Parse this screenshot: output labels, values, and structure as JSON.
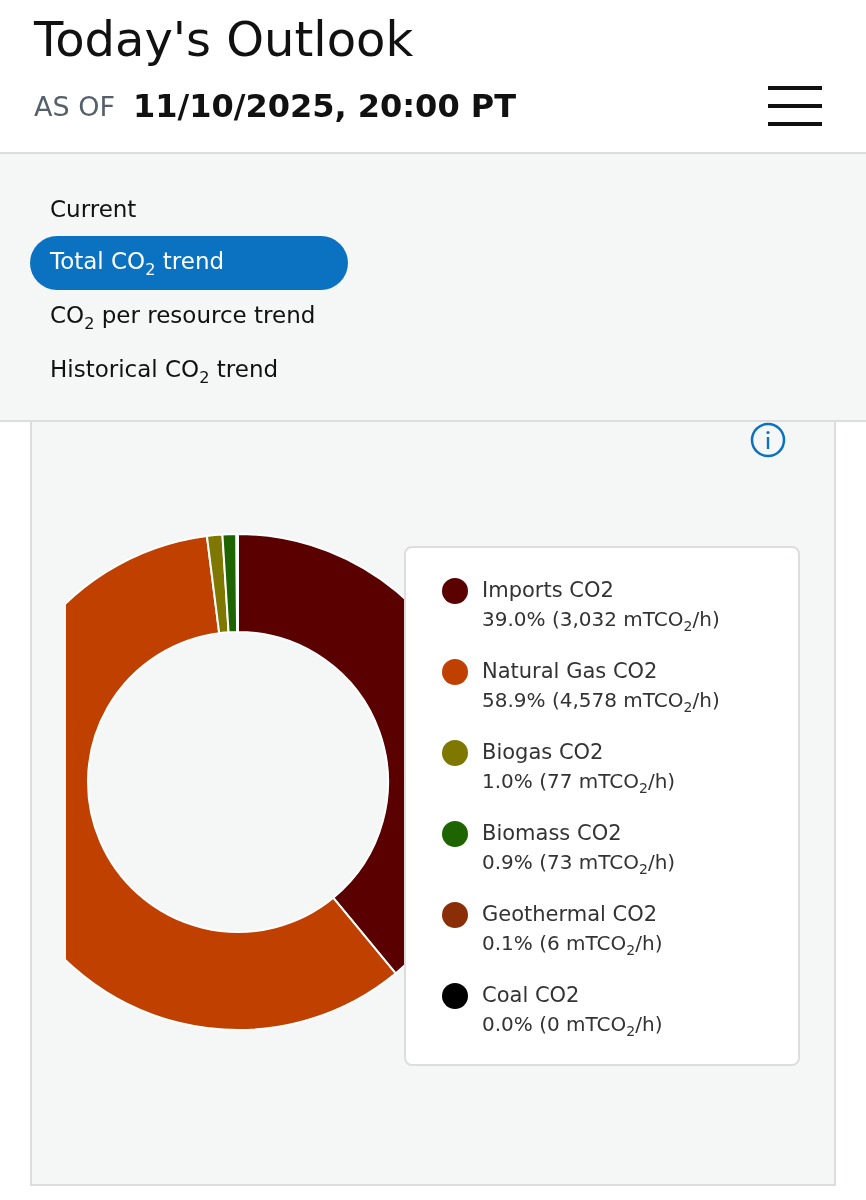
{
  "header": {
    "title": "Today's Outlook",
    "as_of_label": "AS OF",
    "as_of_value": "11/10/2025, 20:00 PT"
  },
  "menu": [
    {
      "label": "Current",
      "selected": false
    },
    {
      "label": "Total CO$_{2}$ trend",
      "selected": true
    },
    {
      "label": "CO$_{2}$ per resource trend",
      "selected": false
    },
    {
      "label": "Historical CO$_{2}$ trend",
      "selected": false
    }
  ],
  "chart": {
    "chart_data": {
      "type": "donut",
      "categories": [
        "Imports CO2",
        "Natural Gas CO2",
        "Biogas CO2",
        "Biomass CO2",
        "Geothermal CO2",
        "Coal CO2"
      ],
      "values": [
        39.0,
        58.9,
        1.0,
        0.9,
        0.1,
        0.0
      ]
    },
    "legend": [
      {
        "detail": "39.0% (3,032 mTCO$_{2}$/h)",
        "color": "#5a0000"
      },
      {
        "detail": "58.9% (4,578 mTCO$_{2}$/h)",
        "color": "#c04000"
      },
      {
        "detail": "1.0% (77 mTCO$_{2}$/h)",
        "color": "#7f7800"
      },
      {
        "detail": "0.9% (73 mTCO$_{2}$/h)",
        "color": "#1e6400"
      },
      {
        "detail": "0.1% (6 mTCO$_{2}$/h)",
        "color": "#8a2e08"
      },
      {
        "detail": "0.0% (0 mTCO$_{2}$/h)",
        "color": "#000000"
      }
    ]
  }
}
